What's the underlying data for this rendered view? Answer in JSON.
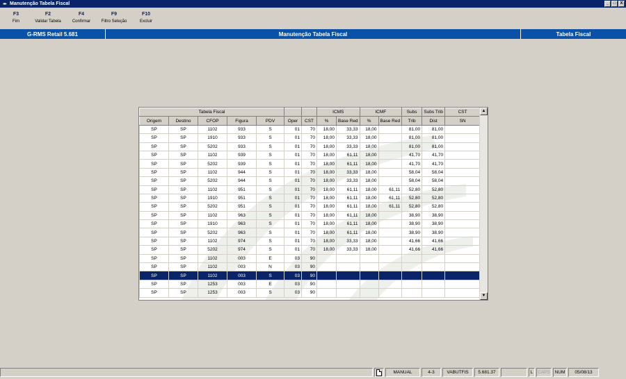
{
  "window": {
    "title": "Manutenção Tabela Fiscal",
    "buttons": [
      "_",
      "□",
      "X"
    ]
  },
  "toolbar": [
    {
      "key": "F3",
      "label": "Fim"
    },
    {
      "key": "F2",
      "label": "Validar Tabela"
    },
    {
      "key": "F4",
      "label": "Confirmar"
    },
    {
      "key": "F9",
      "label": "Filtro Seleção"
    },
    {
      "key": "F10",
      "label": "Excluir"
    }
  ],
  "header": {
    "left": "G-RMS Retail 5.681",
    "center": "Manutenção Tabela Fiscal",
    "right": "Tabela Fiscal"
  },
  "grid": {
    "group_headers": {
      "tabela_fiscal": "Tabela Fiscal",
      "icms": "ICMS",
      "icmf": "ICMF",
      "subs": "Subs",
      "subs_trib": "Subs Trib",
      "cst": "CST"
    },
    "columns": [
      "Origem",
      "Destino",
      "CFOP",
      "Figura",
      "PDV",
      "Oper",
      "CST",
      "%",
      "Base Red",
      "%",
      "Base Red",
      "Trib",
      "Dist",
      "SN"
    ],
    "rows": [
      [
        "SP",
        "SP",
        "1102",
        "933",
        "S",
        "01",
        "70",
        "18,00",
        "33,33",
        "18,00",
        "",
        "81,00",
        "81,00",
        ""
      ],
      [
        "SP",
        "SP",
        "1910",
        "933",
        "S",
        "01",
        "70",
        "18,00",
        "33,33",
        "18,00",
        "",
        "81,00",
        "81,00",
        ""
      ],
      [
        "SP",
        "SP",
        "5202",
        "933",
        "S",
        "01",
        "70",
        "18,00",
        "33,33",
        "18,00",
        "",
        "81,00",
        "81,00",
        ""
      ],
      [
        "SP",
        "SP",
        "1102",
        "939",
        "S",
        "01",
        "70",
        "18,00",
        "61,11",
        "18,00",
        "",
        "41,70",
        "41,70",
        ""
      ],
      [
        "SP",
        "SP",
        "5202",
        "939",
        "S",
        "01",
        "70",
        "18,00",
        "61,11",
        "18,00",
        "",
        "41,70",
        "41,70",
        ""
      ],
      [
        "SP",
        "SP",
        "1102",
        "944",
        "S",
        "01",
        "70",
        "18,00",
        "33,33",
        "18,00",
        "",
        "58,04",
        "58,04",
        ""
      ],
      [
        "SP",
        "SP",
        "5202",
        "944",
        "S",
        "01",
        "70",
        "18,00",
        "33,33",
        "18,00",
        "",
        "58,04",
        "58,04",
        ""
      ],
      [
        "SP",
        "SP",
        "1102",
        "951",
        "S",
        "01",
        "70",
        "18,00",
        "61,11",
        "18,00",
        "61,11",
        "52,80",
        "52,80",
        ""
      ],
      [
        "SP",
        "SP",
        "1910",
        "951",
        "S",
        "01",
        "70",
        "18,00",
        "61,11",
        "18,00",
        "61,11",
        "52,80",
        "52,80",
        ""
      ],
      [
        "SP",
        "SP",
        "5202",
        "951",
        "S",
        "01",
        "70",
        "18,00",
        "61,11",
        "18,00",
        "61,11",
        "52,80",
        "52,80",
        ""
      ],
      [
        "SP",
        "SP",
        "1102",
        "963",
        "S",
        "01",
        "70",
        "18,00",
        "61,11",
        "18,00",
        "",
        "38,90",
        "38,90",
        ""
      ],
      [
        "SP",
        "SP",
        "1910",
        "963",
        "S",
        "01",
        "70",
        "18,00",
        "61,11",
        "18,00",
        "",
        "38,90",
        "38,90",
        ""
      ],
      [
        "SP",
        "SP",
        "5202",
        "963",
        "S",
        "01",
        "70",
        "18,00",
        "61,11",
        "18,00",
        "",
        "38,90",
        "38,90",
        ""
      ],
      [
        "SP",
        "SP",
        "1102",
        "974",
        "S",
        "01",
        "70",
        "18,00",
        "33,33",
        "18,00",
        "",
        "41,66",
        "41,66",
        ""
      ],
      [
        "SP",
        "SP",
        "5202",
        "974",
        "S",
        "01",
        "70",
        "18,00",
        "33,33",
        "18,00",
        "",
        "41,66",
        "41,66",
        ""
      ],
      [
        "SP",
        "SP",
        "1102",
        "003",
        "E",
        "03",
        "90",
        "",
        "",
        "",
        "",
        "",
        "",
        ""
      ],
      [
        "SP",
        "SP",
        "1102",
        "003",
        "N",
        "03",
        "90",
        "",
        "",
        "",
        "",
        "",
        "",
        ""
      ],
      [
        "SP",
        "SP",
        "1102",
        "003",
        "S",
        "03",
        "90",
        "",
        "",
        "",
        "",
        "",
        "",
        ""
      ],
      [
        "SP",
        "SP",
        "1253",
        "003",
        "E",
        "03",
        "90",
        "",
        "",
        "",
        "",
        "",
        "",
        ""
      ],
      [
        "SP",
        "SP",
        "1253",
        "003",
        "S",
        "03",
        "90",
        "",
        "",
        "",
        "",
        "",
        "",
        ""
      ]
    ],
    "selected_row": 17
  },
  "statusbar": {
    "mode": "MANUAL",
    "version_short": "4-3",
    "db": "VABUTFIS",
    "version": "5.681.37",
    "l": "L",
    "caps": "CAPS",
    "num": "NUM",
    "date": "05/08/13"
  },
  "colors": {
    "title_bar": "#0a246a",
    "header_bar": "#0a52a8",
    "selection": "#0a246a",
    "background": "#d4d0c8"
  }
}
